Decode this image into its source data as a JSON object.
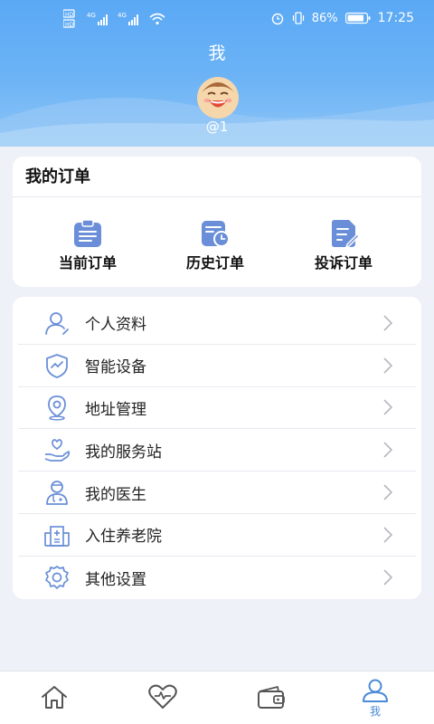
{
  "status_bar": {
    "sim1": "HD",
    "sim2": "HD",
    "net1": "4G",
    "net2": "4G",
    "battery_pct": "86%",
    "time": "17:25"
  },
  "header": {
    "title": "我",
    "username": "@1"
  },
  "orders": {
    "title": "我的订单",
    "items": [
      {
        "label": "当前订单",
        "icon": "clipboard-icon"
      },
      {
        "label": "历史订单",
        "icon": "history-calendar-icon"
      },
      {
        "label": "投诉订单",
        "icon": "edit-document-icon"
      }
    ]
  },
  "menu": {
    "items": [
      {
        "label": "个人资料",
        "icon": "user-profile-icon"
      },
      {
        "label": "智能设备",
        "icon": "shield-chart-icon"
      },
      {
        "label": "地址管理",
        "icon": "location-pin-icon"
      },
      {
        "label": "我的服务站",
        "icon": "hand-heart-icon"
      },
      {
        "label": "我的医生",
        "icon": "doctor-icon"
      },
      {
        "label": "入住养老院",
        "icon": "building-icon"
      },
      {
        "label": "其他设置",
        "icon": "gear-icon"
      }
    ]
  },
  "tabbar": {
    "active_label": "我",
    "tabs": [
      "home-icon",
      "heart-icon",
      "wallet-icon",
      "user-icon"
    ]
  },
  "colors": {
    "accent": "#5aa8f5",
    "icon_blue": "#6a8fd8",
    "tab_active": "#4a8ad6"
  }
}
